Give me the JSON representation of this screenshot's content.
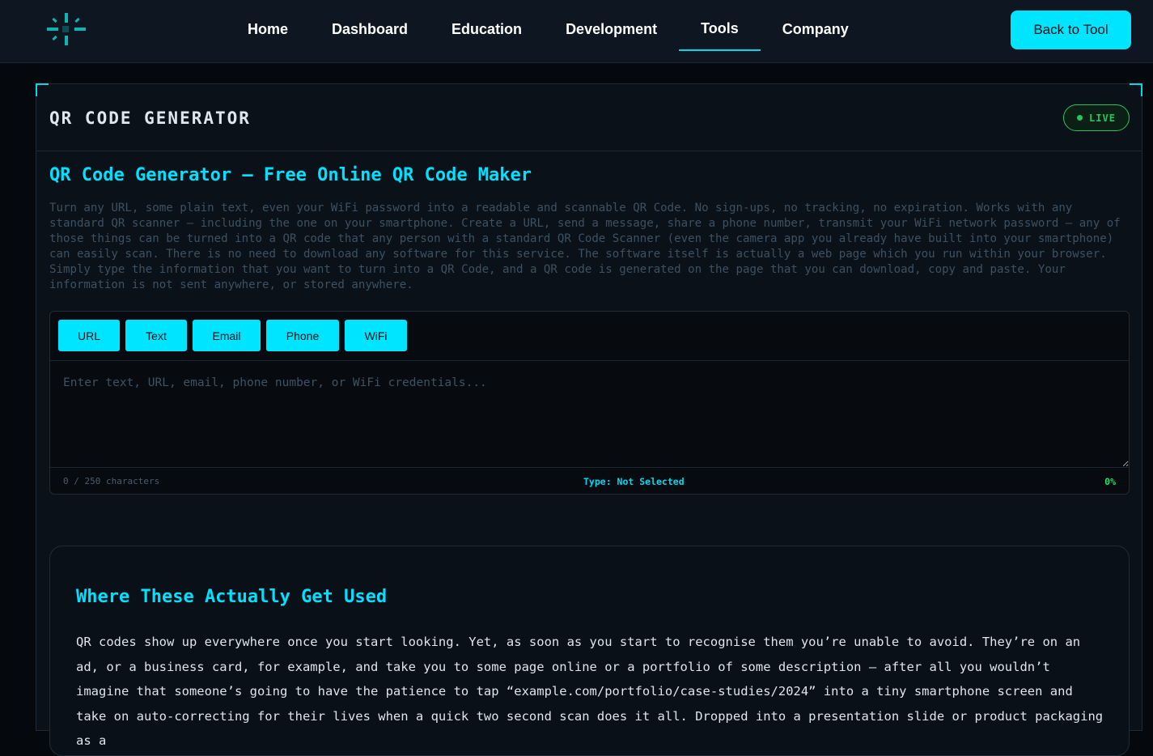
{
  "nav": {
    "links": [
      "Home",
      "Dashboard",
      "Education",
      "Development",
      "Tools",
      "Company"
    ],
    "active": "Tools",
    "back_label": "Back to Tool"
  },
  "panel": {
    "title": "QR CODE GENERATOR",
    "badge": "LIVE"
  },
  "main": {
    "heading": "QR Code Generator – Free Online QR Code Maker",
    "intro": "Turn any URL, some plain text, even your WiFi password into a readable and scannable QR Code. No sign-ups, no tracking, no expiration. Works with any standard QR scanner – including the one on your smartphone. Create a URL, send a message, share a phone number, transmit your WiFi network password – any of those things can be turned into a QR code that any person with a standard QR Code Scanner (even the camera app you already have built into your smartphone) can easily scan. There is no need to download any software for this service. The software itself is actually a web page which you run within your browser. Simply type the information that you want to turn into a QR Code, and a QR code is generated on the page that you can download, copy and paste. Your information is not sent anywhere, or stored anywhere."
  },
  "tool": {
    "types": [
      "URL",
      "Text",
      "Email",
      "Phone",
      "WiFi"
    ],
    "input_value": "",
    "input_placeholder": "Enter text, URL, email, phone number, or WiFi credentials...",
    "char_count": "0 / 250 characters",
    "type_status": "Type: Not Selected",
    "percent": "0%"
  },
  "uses": {
    "heading": "Where These Actually Get Used",
    "text": "QR codes show up everywhere once you start looking. Yet, as soon as you start to recognise them you’re unable to avoid. They’re on an ad, or a business card, for example, and take you to some page online or a portfolio of some description – after all you wouldn’t imagine that someone’s going to have the patience to tap “example.com/portfolio/case-studies/2024” into a tiny smartphone screen and take on auto-correcting for their lives when a quick two second scan does it all. Dropped into a presentation slide or product packaging as a"
  },
  "colors": {
    "accent": "#00e5ff",
    "live_green": "#22c55e",
    "background": "#05090d"
  },
  "icons": {
    "logo": "logo-burst-icon",
    "live": "status-dot-icon"
  }
}
